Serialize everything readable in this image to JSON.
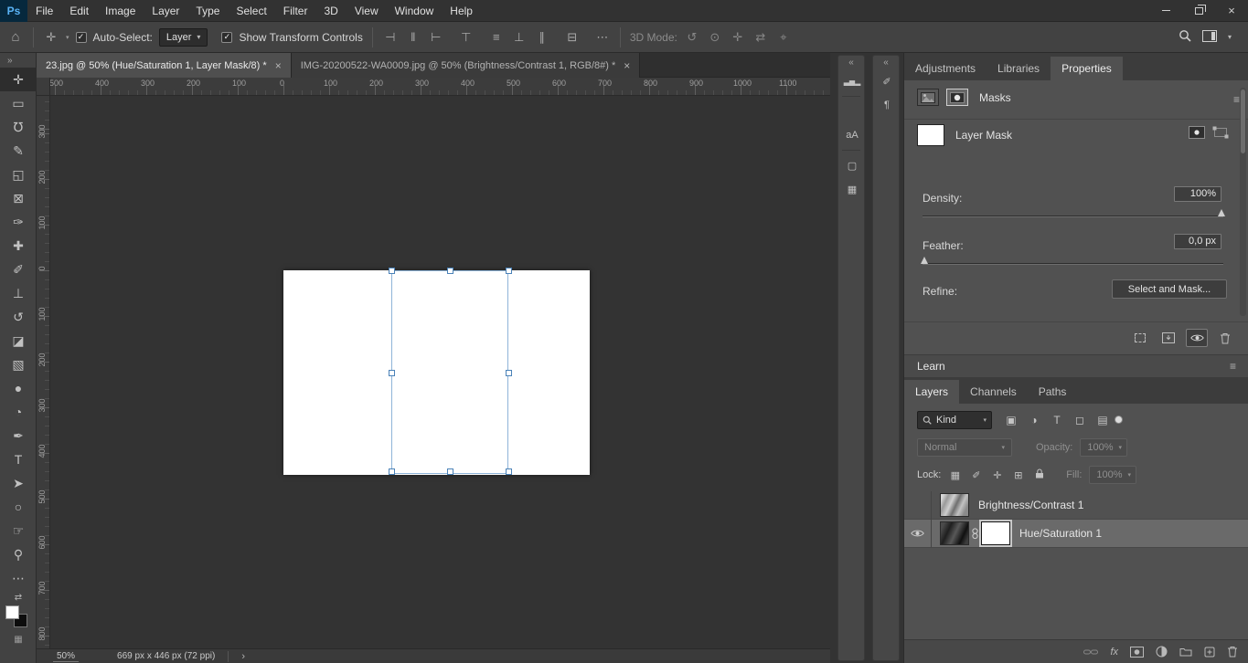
{
  "chrome": {
    "logo": "Ps",
    "close": "×"
  },
  "menubar": {
    "items": [
      "File",
      "Edit",
      "Image",
      "Layer",
      "Type",
      "Select",
      "Filter",
      "3D",
      "View",
      "Window",
      "Help"
    ]
  },
  "glyphs": {
    "home": "⌂",
    "collapse_left": "«",
    "collapse_right": "»",
    "panel_menu": "≡",
    "chevron": "▾",
    "check": "✓",
    "more": "⋯",
    "swap": "⇄",
    "grid": "▦"
  },
  "options_bar": {
    "auto_select_label": "Auto-Select:",
    "auto_select_value": "Layer",
    "show_transform_label": "Show Transform Controls",
    "align_icons": [
      "⊣",
      "‖",
      "⊢",
      "⊤",
      "≡",
      "⊥",
      "∥",
      "⊟"
    ],
    "mode_label": "3D Mode:",
    "mode_icons": [
      "↺",
      "⊙",
      "✛",
      "⇄",
      "⌖"
    ]
  },
  "document_tabs": [
    {
      "title": "23.jpg @ 50% (Hue/Saturation 1, Layer Mask/8) *"
    },
    {
      "title": "IMG-20200522-WA0009.jpg @ 50% (Brightness/Contrast 1, RGB/8#) *"
    }
  ],
  "tools": [
    {
      "name": "move-tool",
      "glyph": "✛"
    },
    {
      "name": "rectangular-marquee-tool",
      "glyph": "▭"
    },
    {
      "name": "lasso-tool",
      "glyph": "℧"
    },
    {
      "name": "quick-selection-tool",
      "glyph": "✎"
    },
    {
      "name": "crop-tool",
      "glyph": "◱"
    },
    {
      "name": "frame-tool",
      "glyph": "⊠"
    },
    {
      "name": "eyedropper-tool",
      "glyph": "✑"
    },
    {
      "name": "spot-healing-brush-tool",
      "glyph": "✚"
    },
    {
      "name": "brush-tool",
      "glyph": "✐"
    },
    {
      "name": "clone-stamp-tool",
      "glyph": "⊥"
    },
    {
      "name": "history-brush-tool",
      "glyph": "↺"
    },
    {
      "name": "eraser-tool",
      "glyph": "◪"
    },
    {
      "name": "gradient-tool",
      "glyph": "▧"
    },
    {
      "name": "blur-tool",
      "glyph": "●"
    },
    {
      "name": "dodge-tool",
      "glyph": "◔"
    },
    {
      "name": "pen-tool",
      "glyph": "✒"
    },
    {
      "name": "type-tool",
      "glyph": "T"
    },
    {
      "name": "path-selection-tool",
      "glyph": "➤"
    },
    {
      "name": "ellipse-tool",
      "glyph": "○"
    },
    {
      "name": "hand-tool",
      "glyph": "☞"
    },
    {
      "name": "zoom-tool",
      "glyph": "⚲"
    },
    {
      "name": "edit-toolbar-button",
      "glyph": "⋯"
    }
  ],
  "rulers": {
    "horizontal": [
      "500",
      "400",
      "300",
      "200",
      "100",
      "0",
      "100",
      "200",
      "300",
      "400",
      "500",
      "600",
      "700",
      "800",
      "900",
      "1000",
      "1100"
    ],
    "vertical": [
      "300",
      "200",
      "100",
      "0",
      "100",
      "200",
      "300",
      "400",
      "500",
      "600",
      "700",
      "800"
    ]
  },
  "status_bar": {
    "zoom": "50%",
    "doc_info": "669 px x 446 px (72 ppi)",
    "chevron": "›"
  },
  "dock_strips": {
    "strip1": [
      {
        "name": "histogram-icon",
        "glyph": "▃▅▂"
      },
      {
        "name": "clone-source-icon",
        "glyph": "⧉"
      },
      {
        "name": "character-icon",
        "glyph": "aA"
      },
      {
        "name": "color-icon",
        "glyph": "▢"
      },
      {
        "name": "patterns-icon",
        "glyph": "▦"
      }
    ],
    "strip2": [
      {
        "name": "brush-settings-icon",
        "glyph": "✐"
      },
      {
        "name": "paragraph-icon",
        "glyph": "¶"
      }
    ]
  },
  "panel_tabs": [
    "Adjustments",
    "Libraries",
    "Properties"
  ],
  "properties": {
    "masks_title": "Masks",
    "layer_mask_label": "Layer Mask",
    "density_label": "Density:",
    "density_value": "100%",
    "feather_label": "Feather:",
    "feather_value": "0,0 px",
    "refine_label": "Refine:",
    "select_and_mask_button": "Select and Mask..."
  },
  "learn_title": "Learn",
  "layers": {
    "tabs": [
      "Layers",
      "Channels",
      "Paths"
    ],
    "kind_label": "Kind",
    "filter_icons": [
      "▣",
      "◑",
      "T",
      "◻",
      "▤"
    ],
    "blend_mode": "Normal",
    "opacity_label": "Opacity:",
    "opacity_value": "100%",
    "lock_label": "Lock:",
    "lock_icons": [
      "▦",
      "✐",
      "✛",
      "⊞"
    ],
    "fill_label": "Fill:",
    "fill_value": "100%",
    "fx_label": "fx",
    "rows": [
      {
        "name": "Brightness/Contrast 1",
        "visible": false,
        "selected": false
      },
      {
        "name": "Hue/Saturation 1",
        "visible": true,
        "selected": true
      }
    ]
  },
  "colors": {
    "accent_blue": "#4a82b8",
    "selection_outline": "#8fb4d8"
  }
}
